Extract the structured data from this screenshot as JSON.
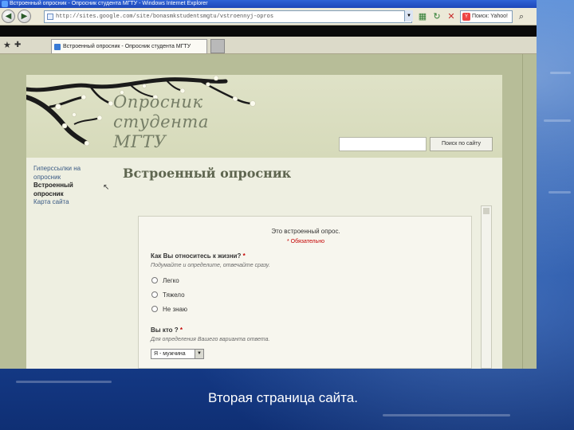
{
  "browser": {
    "window_title": "Встроенный опросник - Опросник студента МГТУ - Windows Internet Explorer",
    "address": "http://sites.google.com/site/bonasmkstudentsmgtu/vstroennyj-opros",
    "search_placeholder": "Поиск: Yahoo!",
    "tab_title": "Встроенный опросник - Опросник студента МГТУ"
  },
  "site": {
    "title_lines": [
      "Опросник",
      "студента",
      "МГТУ"
    ],
    "search_button": "Поиск по сайту",
    "sidebar": {
      "items": [
        "Гиперссылки на опросник",
        "Встроенный опросник",
        "Карта сайта"
      ]
    },
    "page_heading": "Встроенный опросник"
  },
  "form": {
    "title": "Это встроенный опрос.",
    "required_note": "* Обязательно",
    "q1": {
      "label": "Как Вы относитесь к жизни? ",
      "required_mark": "*",
      "hint": "Подумайте и определите, отвечайте сразу.",
      "options": [
        "Легко",
        "Тяжело",
        "Не знаю"
      ]
    },
    "q2": {
      "label": "Вы кто ? ",
      "required_mark": "*",
      "hint": "Для определения Вашего варианта ответа.",
      "selected": "Я - мужчина"
    }
  },
  "caption": "Вторая страница сайта."
}
